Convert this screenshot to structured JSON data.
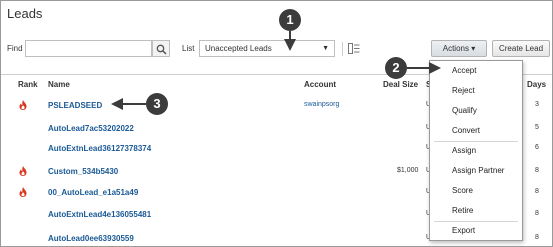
{
  "page": {
    "title": "Leads"
  },
  "toolbar": {
    "find_label": "Find",
    "find_value": "",
    "list_label": "List",
    "list_value": "Unaccepted Leads",
    "actions_label": "Actions ▾",
    "create_label": "Create Lead"
  },
  "columns": {
    "rank": "Rank",
    "name": "Name",
    "account": "Account",
    "deal_size": "Deal Size",
    "status": "S",
    "days": "Days"
  },
  "rows": [
    {
      "hot": true,
      "name": "PSLEADSEED",
      "account": "swainpsorg",
      "deal": "",
      "status": "U",
      "days": "3"
    },
    {
      "hot": false,
      "name": "AutoLead7ac53202022",
      "account": "",
      "deal": "",
      "status": "U",
      "days": "5"
    },
    {
      "hot": false,
      "name": "AutoExtnLead36127378374",
      "account": "",
      "deal": "",
      "status": "U",
      "days": "6"
    },
    {
      "hot": true,
      "name": "Custom_534b5430",
      "account": "",
      "deal": "$1,000",
      "status": "U",
      "days": "8"
    },
    {
      "hot": true,
      "name": "00_AutoLead_e1a51a49",
      "account": "",
      "deal": "",
      "status": "U",
      "days": "8"
    },
    {
      "hot": false,
      "name": "AutoExtnLead4e136055481",
      "account": "",
      "deal": "",
      "status": "U",
      "days": "8"
    },
    {
      "hot": false,
      "name": "AutoLead0ee63930559",
      "account": "",
      "deal": "",
      "status": "U",
      "days": "8"
    }
  ],
  "actions_menu": {
    "items": [
      "Accept",
      "Reject",
      "Qualify",
      "Convert",
      "Assign",
      "Assign Partner",
      "Score",
      "Retire",
      "Export"
    ]
  },
  "callouts": [
    "1",
    "2",
    "3"
  ],
  "colors": {
    "link": "#1a5a96",
    "hot_flame": "#d9381e",
    "callout": "#3c3c3c"
  },
  "icons": [
    "search-icon",
    "freeze-columns-icon",
    "flame-icon",
    "chevron-down-icon"
  ]
}
